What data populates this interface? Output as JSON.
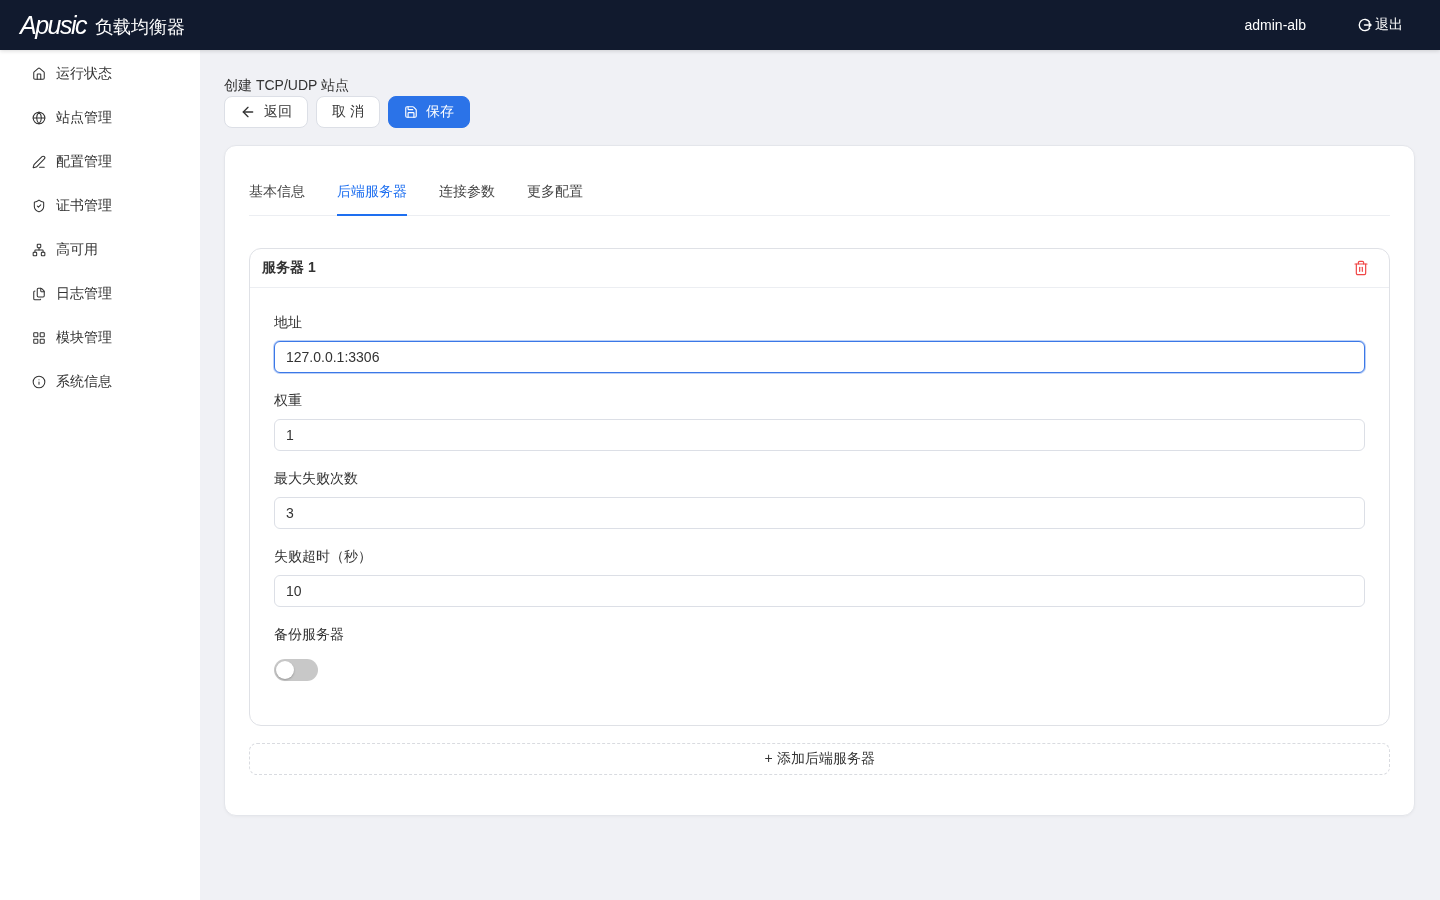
{
  "header": {
    "logo": "Apusic",
    "product": "负载均衡器",
    "user": "admin-alb",
    "logout": "退出"
  },
  "sidebar": {
    "items": [
      {
        "label": "运行状态",
        "selected": false
      },
      {
        "label": "站点管理",
        "selected": false
      },
      {
        "label": "配置管理",
        "selected": false
      },
      {
        "label": "证书管理",
        "selected": false
      },
      {
        "label": "高可用",
        "selected": false
      },
      {
        "label": "日志管理",
        "selected": false
      },
      {
        "label": "模块管理",
        "selected": false
      },
      {
        "label": "系统信息",
        "selected": false
      }
    ]
  },
  "page": {
    "title": "创建 TCP/UDP 站点",
    "buttons": [
      {
        "label": "返回",
        "kind": "back"
      },
      {
        "label": "取 消",
        "kind": "cancel"
      },
      {
        "label": "保存",
        "kind": "save"
      }
    ]
  },
  "tabs": [
    {
      "label": "基本信息",
      "selected": false
    },
    {
      "label": "后端服务器",
      "selected": true
    },
    {
      "label": "连接参数",
      "selected": false
    },
    {
      "label": "更多配置",
      "selected": false
    }
  ],
  "servers": [
    {
      "title": "服务器 1",
      "fields": [
        {
          "label": "地址",
          "value": "127.0.0.1:3306",
          "focused": true
        },
        {
          "label": "权重",
          "value": "1",
          "focused": false
        },
        {
          "label": "最大失败次数",
          "value": "3",
          "focused": false
        },
        {
          "label": "失败超时（秒）",
          "value": "10",
          "focused": false
        }
      ],
      "backup": {
        "label": "备份服务器",
        "on": false
      }
    }
  ],
  "add_server": "+ 添加后端服务器"
}
